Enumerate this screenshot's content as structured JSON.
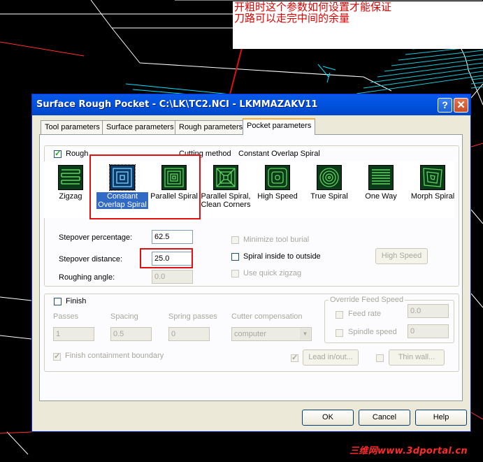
{
  "annotation": {
    "line1": "开粗时这个参数如何设置才能保证",
    "line2": "刀路可以走完中间的余量"
  },
  "watermark": "三维网www.3dportal.cn",
  "dialog": {
    "title": "Surface Rough Pocket - C:\\LK\\TC2.NCI - LKMMAZAKV11",
    "help_glyph": "?",
    "close_glyph": "✕",
    "tabs": [
      {
        "label": "Tool parameters",
        "active": false
      },
      {
        "label": "Surface parameters",
        "active": false
      },
      {
        "label": "Rough parameters",
        "active": false
      },
      {
        "label": "Pocket parameters",
        "active": true
      }
    ]
  },
  "rough": {
    "checkbox_label": "Rough",
    "checked": true,
    "cutting_method_label": "Cutting method",
    "cutting_method_value": "Constant Overlap Spiral",
    "methods": [
      {
        "label": "Zigzag",
        "icon": "zigzag-icon",
        "selected": false
      },
      {
        "label": "Constant Overlap Spiral",
        "icon": "constant-overlap-spiral-icon",
        "selected": true
      },
      {
        "label": "Parallel Spiral",
        "icon": "parallel-spiral-icon",
        "selected": false
      },
      {
        "label": "Parallel Spiral, Clean Corners",
        "icon": "parallel-spiral-clean-corners-icon",
        "selected": false
      },
      {
        "label": "High Speed",
        "icon": "high-speed-icon",
        "selected": false
      },
      {
        "label": "True Spiral",
        "icon": "true-spiral-icon",
        "selected": false
      },
      {
        "label": "One Way",
        "icon": "one-way-icon",
        "selected": false
      },
      {
        "label": "Morph Spiral",
        "icon": "morph-spiral-icon",
        "selected": false
      }
    ],
    "stepover_percentage_label": "Stepover percentage:",
    "stepover_percentage_value": "62.5",
    "stepover_distance_label": "Stepover distance:",
    "stepover_distance_value": "25.0",
    "roughing_angle_label": "Roughing angle:",
    "roughing_angle_value": "0.0",
    "minimize_tool_burial_label": "Minimize tool burial",
    "spiral_inside_outside_label": "Spiral inside to outside",
    "use_quick_zigzag_label": "Use quick zigzag",
    "high_speed_button": "High Speed"
  },
  "finish": {
    "checkbox_label": "Finish",
    "passes_label": "Passes",
    "passes_value": "1",
    "spacing_label": "Spacing",
    "spacing_value": "0.5",
    "spring_passes_label": "Spring passes",
    "spring_passes_value": "0",
    "cutter_compensation_label": "Cutter compensation",
    "cutter_compensation_value": "computer",
    "override_feed_speed_label": "Override Feed Speed",
    "feed_rate_label": "Feed rate",
    "feed_rate_value": "0.0",
    "spindle_speed_label": "Spindle speed",
    "spindle_speed_value": "0",
    "finish_containment_label": "Finish containment boundary",
    "lead_in_out_button": "Lead in/out...",
    "thin_wall_button": "Thin wall..."
  },
  "buttons": {
    "ok": "OK",
    "cancel": "Cancel",
    "help": "Help"
  }
}
